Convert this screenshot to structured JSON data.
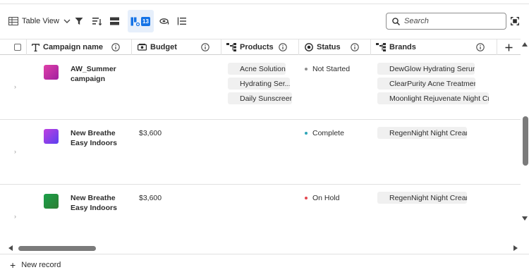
{
  "toolbar": {
    "view_label": "Table View",
    "badge": "13"
  },
  "search": {
    "placeholder": "Search"
  },
  "columns": [
    {
      "label": "Campaign name",
      "icon": "text-type-icon"
    },
    {
      "label": "Budget",
      "icon": "currency-icon"
    },
    {
      "label": "Products",
      "icon": "hierarchy-icon"
    },
    {
      "label": "Status",
      "icon": "single-select-icon"
    },
    {
      "label": "Brands",
      "icon": "hierarchy-icon"
    }
  ],
  "rows": [
    {
      "name": "AW_Summer campaign",
      "budget": "",
      "thumb_colors": [
        "#e040a8",
        "#a020a0"
      ],
      "products": [
        "Acne Solution",
        "Hydrating Ser...",
        "Daily Sunscreen"
      ],
      "status": "Not Started",
      "status_color": "#8e8e8e",
      "brands": [
        "DewGlow Hydrating Serum",
        "ClearPurity Acne Treatment",
        "Moonlight Rejuvenate Night Cr..."
      ]
    },
    {
      "name": "New Breathe Easy Indoors",
      "budget": "$3,600",
      "thumb_colors": [
        "#c040e0",
        "#5a40f0"
      ],
      "products": [],
      "status": "Complete",
      "status_color": "#2fa6b8",
      "brands": [
        "RegenNight Night Cream"
      ]
    },
    {
      "name": "New Breathe Easy Indoors",
      "budget": "$3,600",
      "thumb_colors": [
        "#1aa04a",
        "#2e7d32"
      ],
      "products": [],
      "status": "On Hold",
      "status_color": "#e34850",
      "brands": [
        "RegenNight Night Cream"
      ]
    }
  ],
  "footer": {
    "new_record": "New record"
  }
}
